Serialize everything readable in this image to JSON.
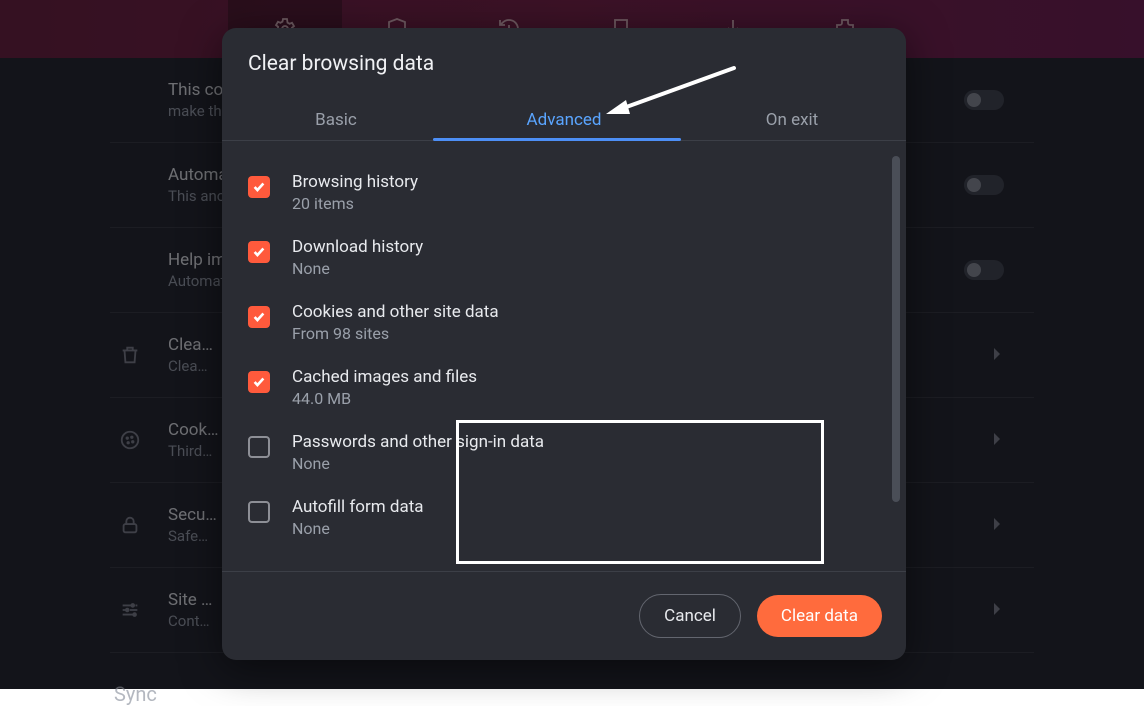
{
  "topbar": {
    "icons": [
      "gear-icon",
      "shield-icon",
      "history-icon",
      "bookmark-icon",
      "download-icon",
      "extension-icon"
    ]
  },
  "background_rows": [
    {
      "title": "This compl…",
      "sub": "make them…",
      "icon": "",
      "toggle": true
    },
    {
      "title": "Automatica…",
      "sub": "This anony…",
      "icon": "",
      "toggle": true
    },
    {
      "title": "Help impro…",
      "sub": "Automatica…",
      "icon": "",
      "toggle": true
    },
    {
      "title": "Clea…",
      "sub": "Clea…",
      "icon": "trash-icon",
      "chevron": true
    },
    {
      "title": "Cook…",
      "sub": "Third…",
      "icon": "cookie-icon",
      "chevron": true
    },
    {
      "title": "Secu…",
      "sub": "Safe…",
      "icon": "lock-icon",
      "chevron": true
    },
    {
      "title": "Site …",
      "sub": "Cont…",
      "icon": "sliders-icon",
      "chevron": true
    }
  ],
  "sync_label": "Sync",
  "dialog": {
    "title": "Clear browsing data",
    "tabs": {
      "basic": "Basic",
      "advanced": "Advanced",
      "onexit": "On exit",
      "active": "advanced"
    },
    "items": [
      {
        "key": "browsing",
        "checked": true,
        "label": "Browsing history",
        "detail": "20 items"
      },
      {
        "key": "download",
        "checked": true,
        "label": "Download history",
        "detail": "None"
      },
      {
        "key": "cookies",
        "checked": true,
        "label": "Cookies and other site data",
        "detail": "From 98 sites"
      },
      {
        "key": "cache",
        "checked": true,
        "label": "Cached images and files",
        "detail": "44.0 MB"
      },
      {
        "key": "passwords",
        "checked": false,
        "label": "Passwords and other sign-in data",
        "detail": "None"
      },
      {
        "key": "autofill",
        "checked": false,
        "label": "Autofill form data",
        "detail": "None"
      }
    ],
    "cancel": "Cancel",
    "clear": "Clear data"
  }
}
